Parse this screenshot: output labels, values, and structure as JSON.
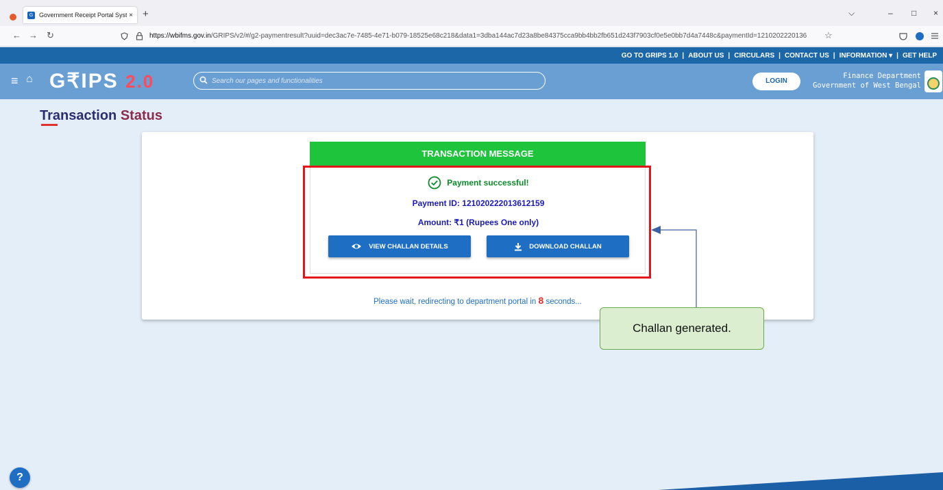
{
  "browser": {
    "tab_title": "Government Receipt Portal Syst",
    "tab_close": "×",
    "new_tab": "+",
    "url_host": "https://wbifms.gov.in",
    "url_rest": "/GRIPS/v2/#/g2-paymentresult?uuid=dec3ac7e-7485-4e71-b079-18525e68c218&data1=3dba144ac7d23a8be84375cca9bb4bb2fb651d243f7903cf0e5e0bb7d4a7448c&paymentId=1210202220136",
    "back": "←",
    "forward": "→",
    "reload": "↻",
    "bookmark_star": "☆",
    "minimize": "–",
    "maximize": "□",
    "close": "×",
    "dropdown": "⌵"
  },
  "toplinks": {
    "grips1": "GO TO GRIPS 1.0",
    "about": "ABOUT US",
    "circulars": "CIRCULARS",
    "contact": "CONTACT US",
    "information": "INFORMATION ▾",
    "help": "GET HELP",
    "sep": "|"
  },
  "header": {
    "logo_main": "G₹IPS",
    "logo_version": "2.0",
    "search_placeholder": "Search our pages and functionalities",
    "login_label": "LOGIN",
    "dept_line1": "Finance Department",
    "dept_line2": "Government of West Bengal"
  },
  "page": {
    "title_part1": "Transaction",
    "title_part2": "Status"
  },
  "transaction": {
    "header": "TRANSACTION MESSAGE",
    "status": "Payment successful!",
    "payment_id": "Payment ID: 121020222013612159",
    "amount": "Amount: ₹1 (Rupees One only)",
    "view_button": "VIEW CHALLAN DETAILS",
    "download_button": "DOWNLOAD CHALLAN",
    "redirect_prefix": "Please wait, redirecting to department portal in ",
    "redirect_seconds": "8",
    "redirect_suffix": " seconds..."
  },
  "annotation": {
    "callout_text": "Challan generated."
  },
  "help_button": "?",
  "colors": {
    "primary": "#1e6ec4",
    "success": "#1ec43c",
    "highlight": "#e3141c",
    "callout_bg": "#dbeecf"
  }
}
